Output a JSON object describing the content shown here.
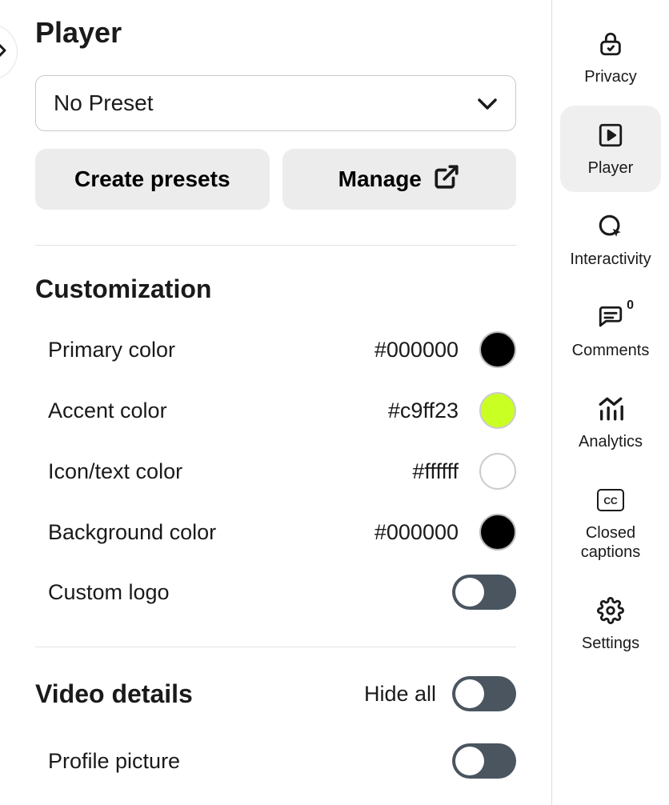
{
  "header": {
    "title": "Player"
  },
  "preset": {
    "selected": "No Preset"
  },
  "buttons": {
    "create": "Create presets",
    "manage": "Manage"
  },
  "customization": {
    "heading": "Customization",
    "primary": {
      "label": "Primary color",
      "hex": "#000000",
      "swatch": "#000000"
    },
    "accent": {
      "label": "Accent color",
      "hex": "#c9ff23",
      "swatch": "#c9ff23"
    },
    "icontext": {
      "label": "Icon/text color",
      "hex": "#ffffff",
      "swatch": "#ffffff"
    },
    "background": {
      "label": "Background color",
      "hex": "#000000",
      "swatch": "#000000"
    },
    "customlogo": {
      "label": "Custom logo"
    }
  },
  "video": {
    "heading": "Video details",
    "hideall_label": "Hide all",
    "profile": {
      "label": "Profile picture"
    }
  },
  "sidebar": {
    "privacy": "Privacy",
    "player": "Player",
    "interactivity": "Interactivity",
    "comments": "Comments",
    "comments_count": "0",
    "analytics": "Analytics",
    "closedcaptions": "Closed captions",
    "settings": "Settings"
  }
}
